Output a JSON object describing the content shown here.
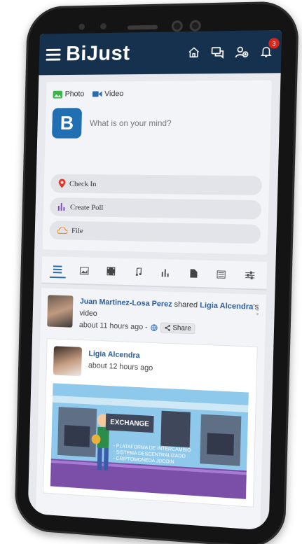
{
  "app": {
    "logo": "BiJust",
    "logo_mark": "B",
    "notification_count": "3"
  },
  "composer": {
    "photo_label": "Photo",
    "video_label": "Video",
    "placeholder": "What is on your mind?",
    "actions": [
      {
        "label": "Check In",
        "icon": "map-pin-icon",
        "color": "#e0342a"
      },
      {
        "label": "Create Poll",
        "icon": "bar-chart-icon",
        "color": "#7c4dbd"
      },
      {
        "label": "File",
        "icon": "cloud-icon",
        "color": "#f08a2a"
      }
    ]
  },
  "tabs": [
    "all-posts",
    "photos",
    "videos",
    "music",
    "polls",
    "files",
    "articles",
    "filters"
  ],
  "post": {
    "author": "Juan Martinez-Losa Perez",
    "action": "shared",
    "target": "Ligia Alcendra",
    "suffix": "'s video",
    "time": "about 11 hours ago -",
    "share_label": "Share",
    "shared": {
      "author": "Ligia Alcendra",
      "time": "about 12 hours ago",
      "video": {
        "sign": "EXCHANGE",
        "lines": [
          "- PLATAFORMA DE INTERCAMBIO",
          "- SISTEMA DESCENTRALIZADO",
          "- CRIPTOMONEDA JDCOIN"
        ]
      }
    }
  },
  "colors": {
    "header": "#16314d",
    "link": "#2a5d9a",
    "badge": "#d9261c",
    "photo_icon": "#3bb54a",
    "video_icon": "#2a6bb0"
  }
}
